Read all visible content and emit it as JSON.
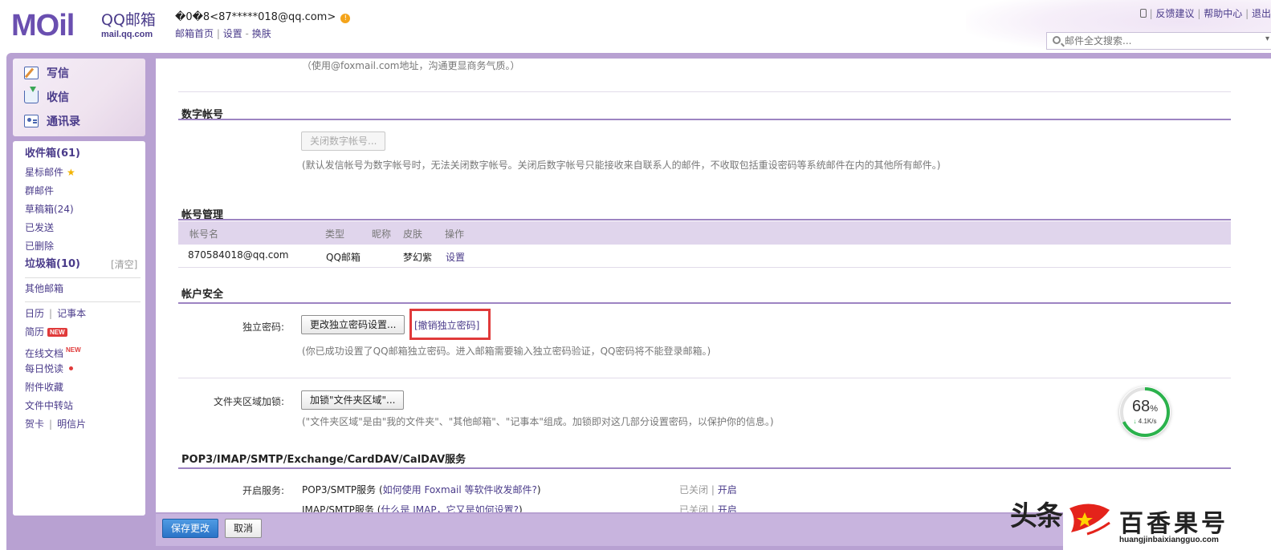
{
  "header": {
    "logo_text": "MOil",
    "product_name": "QQ邮箱",
    "product_domain": "mail.qq.com",
    "user_email": "�0�8<87*****018@qq.com>",
    "links": [
      "邮箱首页",
      "设置",
      "换肤"
    ],
    "top_right": [
      "反馈建议",
      "帮助中心",
      "退出"
    ],
    "search_placeholder": "邮件全文搜索..."
  },
  "sidebar": {
    "quick": [
      "写信",
      "收信",
      "通讯录"
    ],
    "folders": {
      "inbox": "收件箱(61)",
      "starred": "星标邮件",
      "group": "群邮件",
      "drafts": "草稿箱(24)",
      "sent": "已发送",
      "deleted": "已删除",
      "junk": "垃圾箱(10)",
      "clear": "[清空]",
      "other": "其他邮箱",
      "calendar": "日历",
      "notes": "记事本",
      "resume": "简历",
      "resume_badge": "NEW",
      "docs": "在线文档",
      "docs_badge": "NEW",
      "daily": "每日悦读",
      "attachments": "附件收藏",
      "transfer": "文件中转站",
      "cards": "贺卡",
      "postcard": "明信片"
    }
  },
  "content": {
    "top_hint": "（使用@foxmail.com地址，沟通更显商务气质。）",
    "digital": {
      "title": "数字帐号",
      "button": "关闭数字帐号...",
      "hint": "(默认发信帐号为数字帐号时，无法关闭数字帐号。关闭后数字帐号只能接收来自联系人的邮件，不收取包括重设密码等系统邮件在内的其他所有邮件。)"
    },
    "accounts": {
      "title": "帐号管理",
      "headers": [
        "帐号名",
        "类型",
        "昵称",
        "皮肤",
        "操作"
      ],
      "rows": [
        {
          "name": "870584018@qq.com",
          "type": "QQ邮箱",
          "nickname": "",
          "skin": "梦幻紫",
          "action": "设置"
        }
      ]
    },
    "security": {
      "title": "帐户安全",
      "pwd_label": "独立密码:",
      "pwd_button": "更改独立密码设置...",
      "revoke_link": "[撤销独立密码]",
      "pwd_hint": "(你已成功设置了QQ邮箱独立密码。进入邮箱需要输入独立密码验证，QQ密码将不能登录邮箱。)",
      "lock_label": "文件夹区域加锁:",
      "lock_button": "加锁\"文件夹区域\"...",
      "lock_hint": "(\"文件夹区域\"是由\"我的文件夹\"、\"其他邮箱\"、\"记事本\"组成。加锁即对这几部分设置密码，以保护你的信息。)"
    },
    "services": {
      "title": "POP3/IMAP/SMTP/Exchange/CardDAV/CalDAV服务",
      "label": "开启服务:",
      "items": [
        {
          "name": "POP3/SMTP服务",
          "help": "如何使用 Foxmail 等软件收发邮件?",
          "state_off": "已关闭",
          "state_on": "开启"
        },
        {
          "name": "IMAP/SMTP服务",
          "help": "什么是 IMAP，它又是如何设置?",
          "state_off": "已关闭",
          "state_on": "开启"
        }
      ]
    }
  },
  "gauge": {
    "percent": 68,
    "percent_text": "68",
    "unit": "%",
    "speed": "4.1K/s"
  },
  "bottom": {
    "save": "保存更改",
    "cancel": "取消"
  },
  "watermark": {
    "toutiao": "头条",
    "brand": "百香果号",
    "url": "huangjinbaixiangguo.com"
  },
  "colors": {
    "accent": "#4a3b8a",
    "frame": "#b8a1d2",
    "highlight_box": "#e03a3a",
    "save_button": "#2a73c7"
  }
}
